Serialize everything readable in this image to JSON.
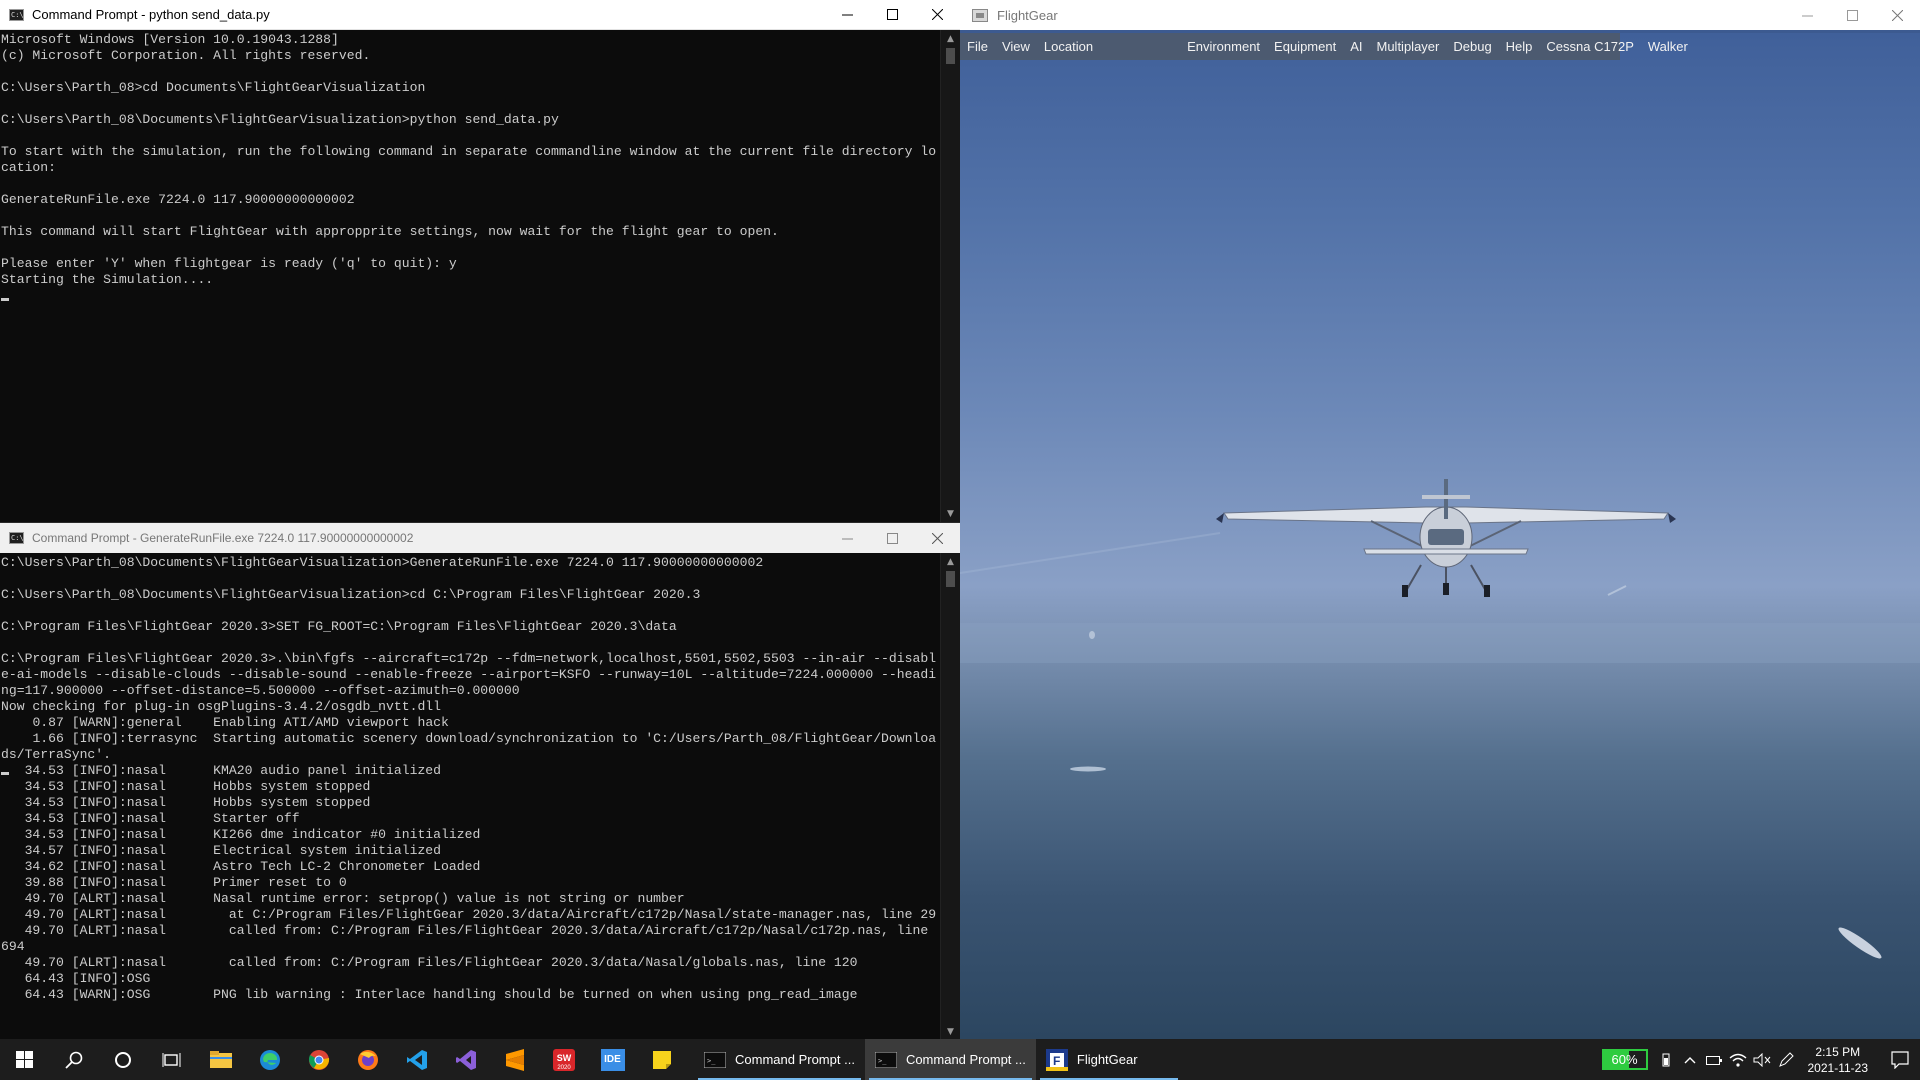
{
  "cmd_top": {
    "title": "Command Prompt - python  send_data.py",
    "lines": [
      "Microsoft Windows [Version 10.0.19043.1288]",
      "(c) Microsoft Corporation. All rights reserved.",
      "",
      "C:\\Users\\Parth_08>cd Documents\\FlightGearVisualization",
      "",
      "C:\\Users\\Parth_08\\Documents\\FlightGearVisualization>python send_data.py",
      "",
      "To start with the simulation, run the following command in separate commandline window at the current file directory location:",
      "",
      "GenerateRunFile.exe 7224.0 117.90000000000002",
      "",
      "This command will start FlightGear with appropprite settings, now wait for the flight gear to open.",
      "",
      "Please enter 'Y' when flightgear is ready ('q' to quit): y",
      "Starting the Simulation...."
    ]
  },
  "cmd_bottom": {
    "title": "Command Prompt - GenerateRunFile.exe  7224.0 117.90000000000002",
    "lines_before_cursor": [
      "C:\\Users\\Parth_08\\Documents\\FlightGearVisualization>GenerateRunFile.exe 7224.0 117.90000000000002",
      "",
      "C:\\Users\\Parth_08\\Documents\\FlightGearVisualization>cd C:\\Program Files\\FlightGear 2020.3",
      "",
      "C:\\Program Files\\FlightGear 2020.3>SET FG_ROOT=C:\\Program Files\\FlightGear 2020.3\\data",
      "",
      "C:\\Program Files\\FlightGear 2020.3>.\\bin\\fgfs --aircraft=c172p --fdm=network,localhost,5501,5502,5503 --in-air --disable-ai-models --disable-clouds --disable-sound --enable-freeze --airport=KSFO --runway=10L --altitude=7224.000000 --heading=117.900000 --offset-distance=5.500000 --offset-azimuth=0.000000",
      "Now checking for plug-in osgPlugins-3.4.2/osgdb_nvtt.dll",
      "    0.87 [WARN]:general    Enabling ATI/AMD viewport hack",
      "    1.66 [INFO]:terrasync  Starting automatic scenery download/synchronization to 'C:/Users/Parth_08/FlightGear/Downloads/TerraSync'."
    ],
    "cursor_line": "   34.53 [INFO]:nasal      KMA20 audio panel initialized",
    "lines_after_cursor": [
      "   34.53 [INFO]:nasal      Hobbs system stopped",
      "   34.53 [INFO]:nasal      Hobbs system stopped",
      "   34.53 [INFO]:nasal      Starter off",
      "   34.53 [INFO]:nasal      KI266 dme indicator #0 initialized",
      "   34.57 [INFO]:nasal      Electrical system initialized",
      "   34.62 [INFO]:nasal      Astro Tech LC-2 Chronometer Loaded",
      "   39.88 [INFO]:nasal      Primer reset to 0",
      "   49.70 [ALRT]:nasal      Nasal runtime error: setprop() value is not string or number",
      "   49.70 [ALRT]:nasal        at C:/Program Files/FlightGear 2020.3/data/Aircraft/c172p/Nasal/state-manager.nas, line 29",
      "   49.70 [ALRT]:nasal        called from: C:/Program Files/FlightGear 2020.3/data/Aircraft/c172p/Nasal/c172p.nas, line 694",
      "   49.70 [ALRT]:nasal        called from: C:/Program Files/FlightGear 2020.3/data/Nasal/globals.nas, line 120",
      "   64.43 [INFO]:OSG",
      "   64.43 [WARN]:OSG        PNG lib warning : Interlace handling should be turned on when using png_read_image"
    ]
  },
  "flightgear": {
    "title": "FlightGear",
    "menu_left": [
      "File",
      "View",
      "Location"
    ],
    "menu_right": [
      "Environment",
      "Equipment",
      "AI",
      "Multiplayer",
      "Debug",
      "Help",
      "Cessna C172P",
      "Walker"
    ],
    "sky_color": "#5a78ac",
    "sea_color": "#3a5472"
  },
  "taskbar": {
    "pinned_icons": [
      "windows-start-icon",
      "search-icon",
      "cortana-icon",
      "task-view-icon",
      "file-explorer-icon",
      "edge-icon",
      "chrome-icon",
      "firefox-icon",
      "vscode-icon",
      "visual-studio-icon",
      "sublime-text-icon",
      "solidworks-icon",
      "ide-icon",
      "sticky-notes-icon"
    ],
    "ide_label": "IDE",
    "sw_label": "SW",
    "sw_sub": "2020",
    "tasks": [
      "Command Prompt ...",
      "Command Prompt ...",
      "FlightGear"
    ],
    "battery": "60%",
    "battery_level": 0.6,
    "time": "2:15 PM",
    "date": "2021-11-23"
  },
  "colors": {
    "console_bg": "#0c0c0c",
    "console_text": "#cccccc",
    "taskbar_bg": "#1d1d1d",
    "battery_green": "#2ecc40"
  }
}
